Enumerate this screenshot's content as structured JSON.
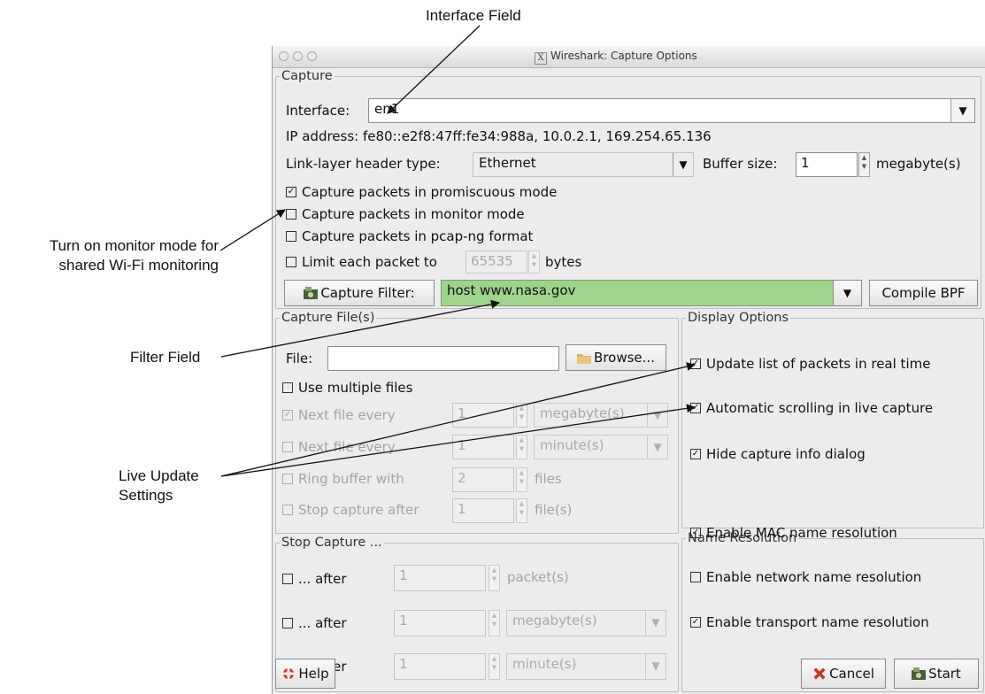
{
  "annotations": {
    "interface": "Interface Field",
    "monitor_line1": "Turn on monitor mode for",
    "monitor_line2": "shared Wi-Fi monitoring",
    "filter": "Filter Field",
    "live_line1": "Live Update",
    "live_line2": "Settings"
  },
  "window": {
    "title": "Wireshark: Capture Options"
  },
  "capture": {
    "legend": "Capture",
    "interface_label": "Interface:",
    "interface_value": "en1",
    "ip_address": "IP address: fe80::e2f8:47ff:fe34:988a, 10.0.2.1, 169.254.65.136",
    "link_layer_label": "Link-layer header type:",
    "link_layer_value": "Ethernet",
    "buffer_label": "Buffer size:",
    "buffer_value": "1",
    "buffer_unit": "megabyte(s)",
    "promiscuous": "Capture packets in promiscuous mode",
    "monitor": "Capture packets in monitor mode",
    "pcapng": "Capture packets in pcap-ng format",
    "limit_label": "Limit each packet to",
    "limit_value": "65535",
    "limit_unit": "bytes",
    "filter_button": "Capture Filter:",
    "filter_value": "host www.nasa.gov",
    "compile_button": "Compile BPF"
  },
  "capture_files": {
    "legend": "Capture File(s)",
    "file_label": "File:",
    "file_value": "",
    "browse_button": "Browse...",
    "multiple_files": "Use multiple files",
    "next_file_every_1": "Next file every",
    "next_file_every_1_value": "1",
    "next_file_every_1_unit": "megabyte(s)",
    "next_file_every_2": "Next file every",
    "next_file_every_2_value": "1",
    "next_file_every_2_unit": "minute(s)",
    "ring_buffer": "Ring buffer with",
    "ring_buffer_value": "2",
    "ring_buffer_unit": "files",
    "stop_after": "Stop capture after",
    "stop_after_value": "1",
    "stop_after_unit": "file(s)"
  },
  "display_options": {
    "legend": "Display Options",
    "update_realtime": "Update list of packets in real time",
    "auto_scroll": "Automatic scrolling in live capture",
    "hide_info": "Hide capture info dialog"
  },
  "name_resolution": {
    "legend": "Name Resolution",
    "mac": "Enable MAC name resolution",
    "network": "Enable network name resolution",
    "transport": "Enable transport name resolution"
  },
  "stop_capture": {
    "legend": "Stop Capture ...",
    "after_label": "... after",
    "row1_value": "1",
    "row1_unit": "packet(s)",
    "row2_value": "1",
    "row2_unit": "megabyte(s)",
    "row3_value": "1",
    "row3_unit": "minute(s)"
  },
  "buttons": {
    "help": "Help",
    "cancel": "Cancel",
    "start": "Start"
  }
}
